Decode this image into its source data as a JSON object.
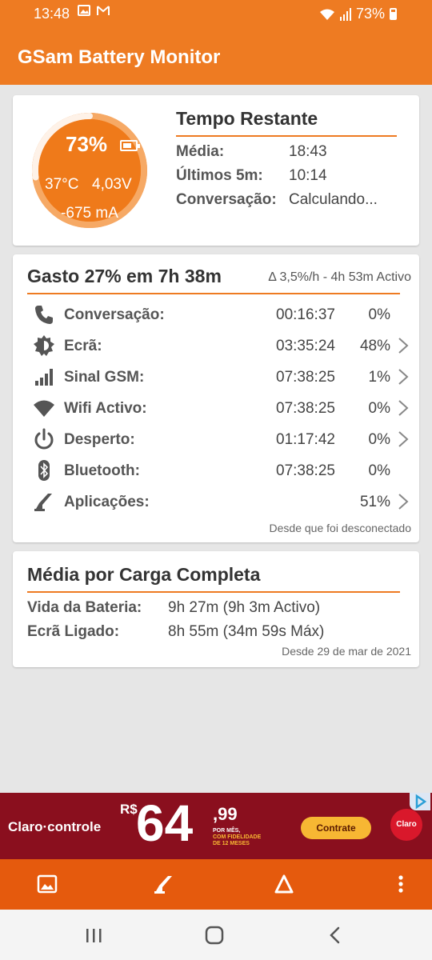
{
  "status_bar": {
    "time": "13:48",
    "battery": "73%"
  },
  "app": {
    "title": "GSam Battery Monitor"
  },
  "battery": {
    "percent": "73%",
    "temperature": "37°C",
    "voltage": "4,03V",
    "current": "-675 mA",
    "level": 0.73
  },
  "time_remaining": {
    "title": "Tempo Restante",
    "rows": [
      {
        "label": "Média:",
        "value": "18:43"
      },
      {
        "label": "Últimos 5m:",
        "value": "10:14"
      },
      {
        "label": "Conversação:",
        "value": "Calculando..."
      }
    ]
  },
  "usage": {
    "title": "Gasto 27% em 7h 38m",
    "rate": "Δ 3,5%/h - 4h 53m Activo",
    "rows": [
      {
        "icon": "phone-icon",
        "label": "Conversação:",
        "time": "00:16:37",
        "percent": "0%",
        "chevron": false
      },
      {
        "icon": "brightness-icon",
        "label": "Ecrã:",
        "time": "03:35:24",
        "percent": "48%",
        "chevron": true
      },
      {
        "icon": "signal-icon",
        "label": "Sinal GSM:",
        "time": "07:38:25",
        "percent": "1%",
        "chevron": true
      },
      {
        "icon": "wifi-icon",
        "label": "Wifi Activo:",
        "time": "07:38:25",
        "percent": "0%",
        "chevron": true
      },
      {
        "icon": "power-icon",
        "label": "Desperto:",
        "time": "01:17:42",
        "percent": "0%",
        "chevron": true
      },
      {
        "icon": "bluetooth-icon",
        "label": "Bluetooth:",
        "time": "07:38:25",
        "percent": "0%",
        "chevron": false
      },
      {
        "icon": "apps-icon",
        "label": "Aplicações:",
        "time": "",
        "percent": "51%",
        "chevron": true
      }
    ],
    "footer": "Desde que foi desconectado"
  },
  "average_full_charge": {
    "title": "Média por Carga Completa",
    "rows": [
      {
        "label": "Vida da Bateria:",
        "value": "9h 27m (9h 3m Activo)"
      },
      {
        "label": "Ecrã Ligado:",
        "value": "8h 55m (34m 59s Máx)"
      }
    ],
    "footer": "Desde 29 de mar de 2021"
  },
  "ad": {
    "brand": "Claro·controle",
    "currency": "R$",
    "price_main": "64",
    "price_cents": ",99",
    "fine_print_1": "POR MÊS,",
    "fine_print_2": "COM FIDELIDADE",
    "fine_print_3": "DE 12 MESES",
    "cta": "Contrate",
    "logo": "Claro"
  },
  "colors": {
    "accent": "#ee7b22",
    "toolbar": "#e55a0d",
    "gauge": "#ef7a1a"
  }
}
